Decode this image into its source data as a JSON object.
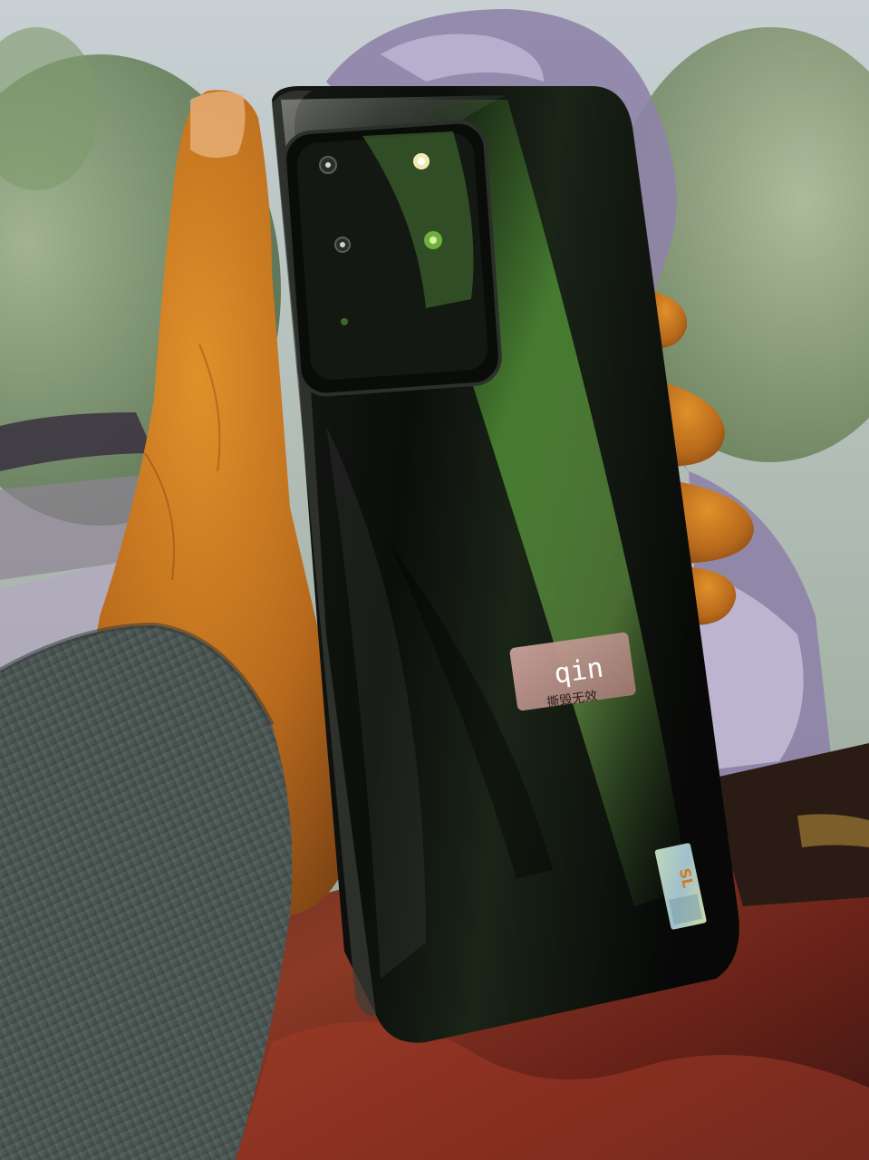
{
  "scene": {
    "subject": "phone-back",
    "palette": {
      "sky": "#bcc6c8",
      "foliage": "#6f8a5e",
      "phone_body": "#0e110e",
      "green_reflection": "#3f6b2a",
      "skin": "#c97a22",
      "sleeve": "#4e5a56",
      "mat": "#7a2a22"
    }
  },
  "sticker": {
    "brand": "qin",
    "subtitle": "撕毁无效"
  },
  "badge": {
    "text": "SL"
  }
}
